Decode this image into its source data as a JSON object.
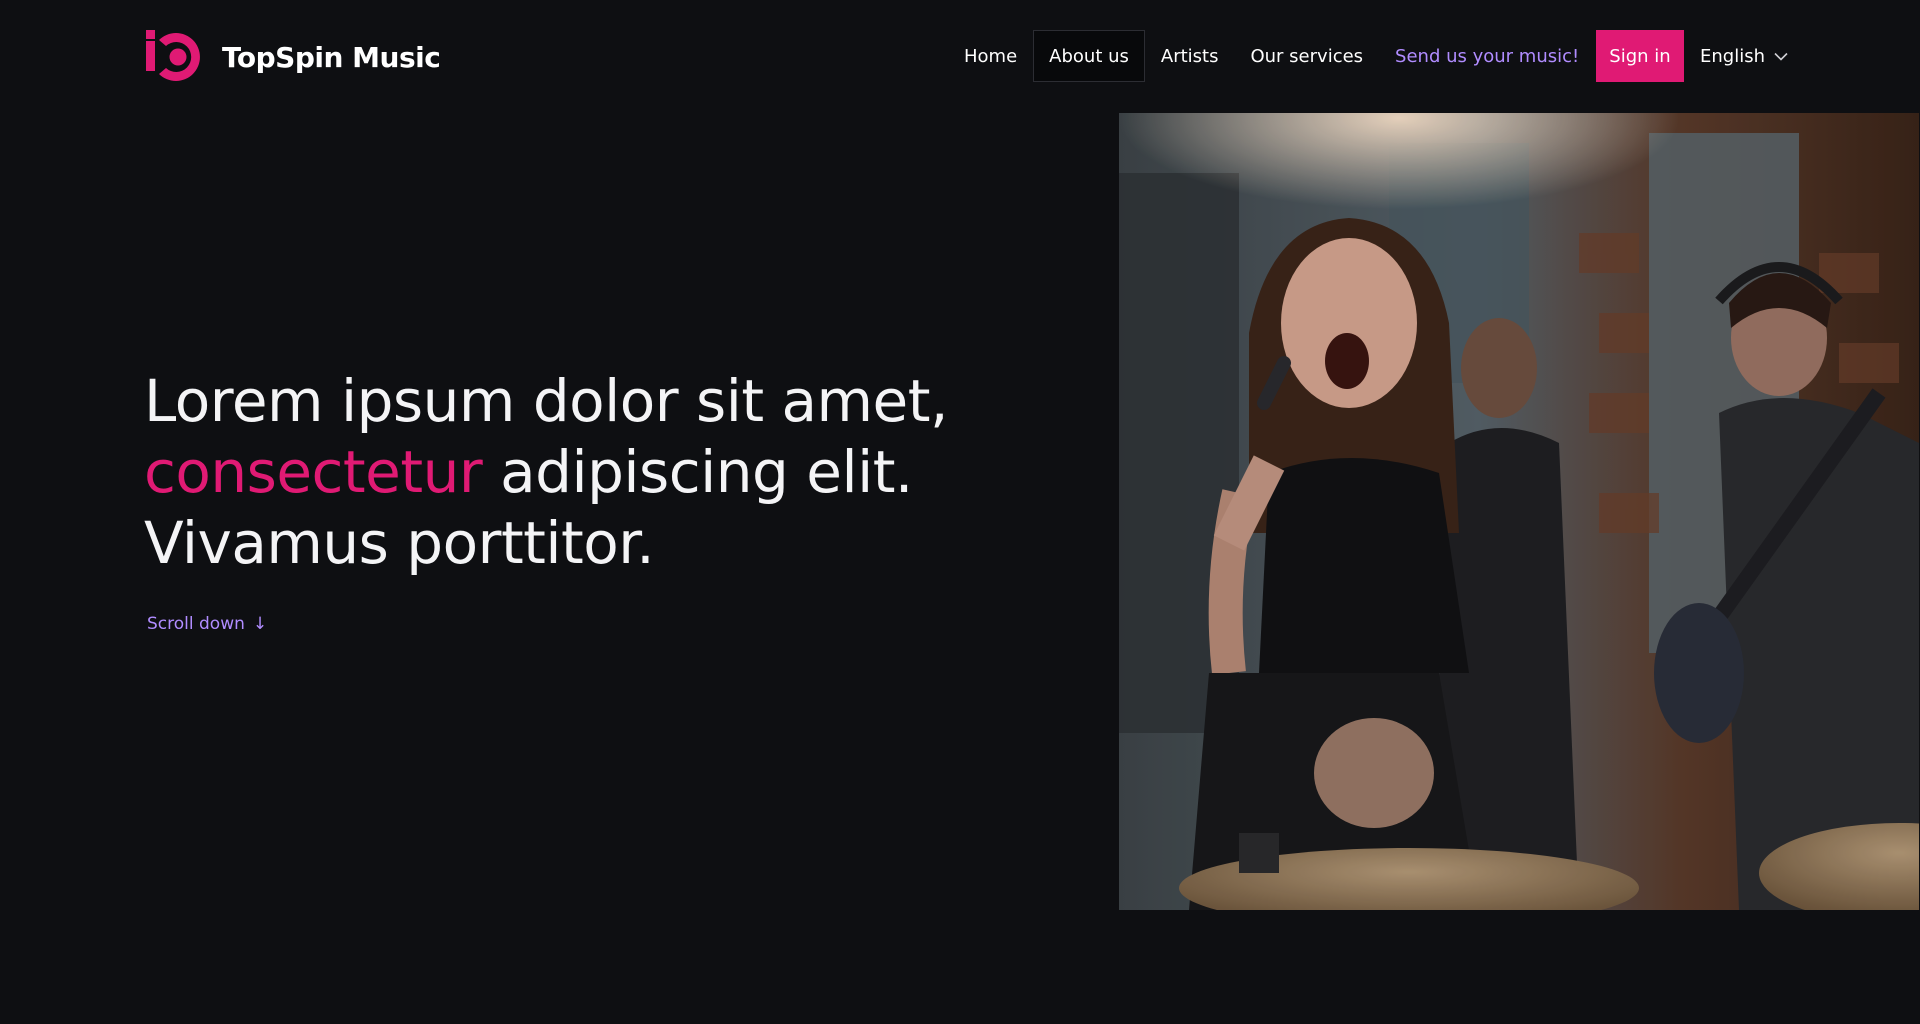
{
  "brand": {
    "name": "TopSpin Music",
    "icon": "topspin-logo-icon",
    "accent_color": "#e01a74",
    "link_color": "#b08cff",
    "background_color": "#0e0f12"
  },
  "nav": {
    "items": [
      {
        "label": "Home",
        "active": false
      },
      {
        "label": "About us",
        "active": true
      },
      {
        "label": "Artists",
        "active": false
      },
      {
        "label": "Our services",
        "active": false
      }
    ],
    "cta_label": "Send us your music!",
    "signin_label": "Sign in",
    "language": "English",
    "language_icon": "chevron-down-icon"
  },
  "hero": {
    "line1": "Lorem ipsum dolor sit amet,",
    "line2_accent": "consectetur",
    "line2_rest": " adipiscing elit.",
    "line3": "Vivamus porttitor.",
    "scroll_label": "Scroll down",
    "scroll_arrow": "↓",
    "image_subject": "band performing in studio"
  }
}
